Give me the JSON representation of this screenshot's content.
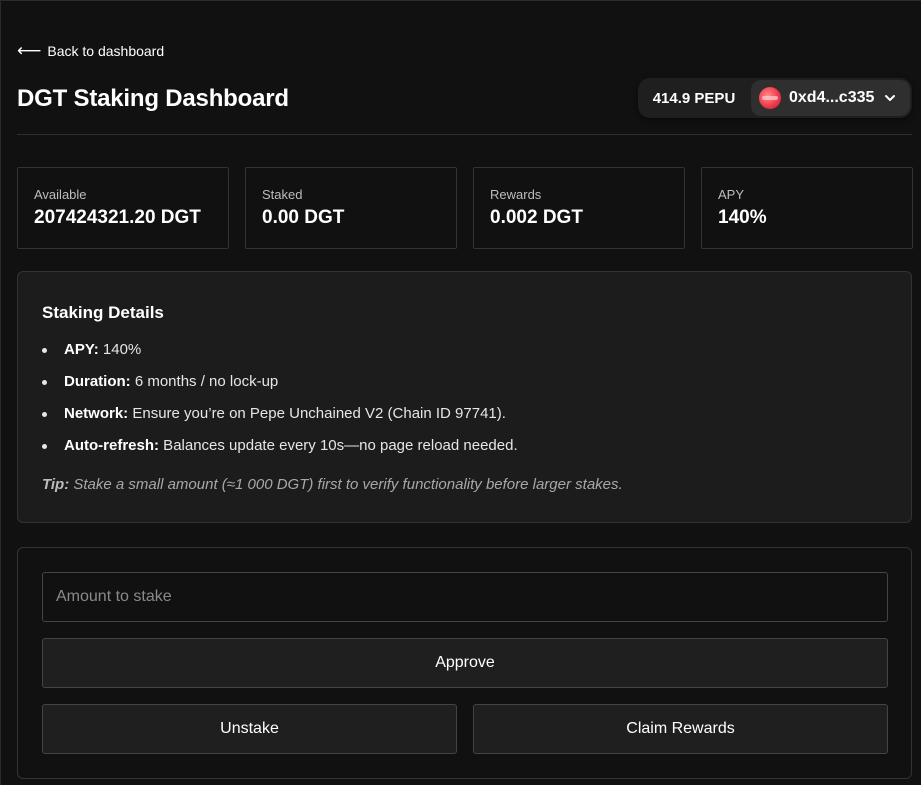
{
  "header": {
    "back_arrow": "⟵",
    "back_label": "Back to dashboard",
    "title": "DGT Staking Dashboard"
  },
  "wallet": {
    "balance": "414.9 PEPU",
    "address": "0xd4...c335",
    "avatar_icon": "account-avatar-icon",
    "chevron_icon": "chevron-down-icon"
  },
  "stats": [
    {
      "label": "Available",
      "value": "207424321.20 DGT"
    },
    {
      "label": "Staked",
      "value": "0.00 DGT"
    },
    {
      "label": "Rewards",
      "value": "0.002 DGT"
    },
    {
      "label": "APY",
      "value": "140%"
    }
  ],
  "details": {
    "title": "Staking Details",
    "items": [
      {
        "key": "APY:",
        "text": " 140%"
      },
      {
        "key": "Duration:",
        "text": " 6 months / no lock-up"
      },
      {
        "key": "Network:",
        "text": " Ensure you’re on Pepe Unchained V2 (Chain ID 97741)."
      },
      {
        "key": "Auto-refresh:",
        "text": " Balances update every 10s—no page reload needed."
      }
    ],
    "tip_label": "Tip:",
    "tip_text": " Stake a small amount (≈1 000 DGT) first to verify functionality before larger stakes."
  },
  "form": {
    "amount_placeholder": "Amount to stake",
    "amount_value": "",
    "approve_label": "Approve",
    "unstake_label": "Unstake",
    "claim_label": "Claim Rewards"
  },
  "colors": {
    "background": "#111111",
    "card": "#1c1c1c",
    "border": "#333333",
    "text": "#ffffff",
    "muted": "#bdbdbd",
    "avatar": "#ef3b4c"
  }
}
